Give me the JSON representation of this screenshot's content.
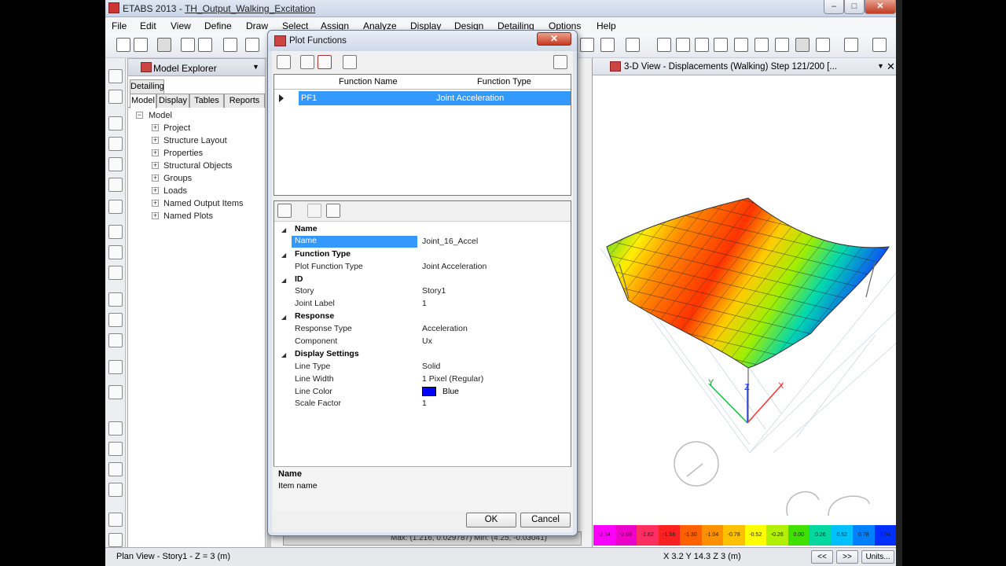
{
  "window": {
    "app": "ETABS 2013",
    "sep": " - ",
    "file": "TH_Output_Walking_Excitation",
    "min": "–",
    "max": "□",
    "close": "✕"
  },
  "menu": [
    "File",
    "Edit",
    "View",
    "Define",
    "Draw",
    "Select",
    "Assign",
    "Analyze",
    "Display",
    "Design",
    "Detailing",
    "Options",
    "Help"
  ],
  "explorer": {
    "title": "Model Explorer",
    "tabs": [
      "Detailing",
      "Model",
      "Display",
      "Tables",
      "Reports"
    ],
    "tree": {
      "root": "Model",
      "items": [
        "Project",
        "Structure Layout",
        "Properties",
        "Structural Objects",
        "Groups",
        "Loads",
        "Named Output Items",
        "Named Plots"
      ]
    }
  },
  "view3d": {
    "title": "3-D View   - Displacements (Walking)  Step 121/200  [...",
    "axes": {
      "x": "X",
      "y": "Y",
      "z": "Z"
    }
  },
  "colorbar": {
    "labels": [
      "-2.34",
      "-2.08",
      "-1.82",
      "-1.56",
      "-1.30",
      "-1.04",
      "-0.78",
      "-0.52",
      "-0.26",
      "0.00",
      "0.26",
      "0.52",
      "0.78",
      "1.04"
    ],
    "colors": [
      "#ff00ff",
      "#ee00cc",
      "#ff3060",
      "#ff2020",
      "#ff6000",
      "#ff9000",
      "#ffc000",
      "#ffff00",
      "#b0f000",
      "#40e000",
      "#00d8a0",
      "#00c0ff",
      "#0080ff",
      "#0030ff"
    ]
  },
  "dialog": {
    "title": "Plot Functions",
    "table": {
      "headers": [
        "Function Name",
        "Function Type"
      ],
      "rows": [
        {
          "name": "PF1",
          "type": "Joint Acceleration"
        }
      ]
    },
    "properties": {
      "name_cat": "Name",
      "name_key": "Name",
      "name_val": "Joint_16_Accel",
      "ftype_cat": "Function Type",
      "ftype_key": "Plot Function Type",
      "ftype_val": "Joint Acceleration",
      "id_cat": "ID",
      "story_key": "Story",
      "story_val": "Story1",
      "joint_key": "Joint Label",
      "joint_val": "1",
      "resp_cat": "Response",
      "rtype_key": "Response Type",
      "rtype_val": "Acceleration",
      "comp_key": "Component",
      "comp_val": "Ux",
      "disp_cat": "Display Settings",
      "ltype_key": "Line Type",
      "ltype_val": "Solid",
      "lwidth_key": "Line Width",
      "lwidth_val": "1 Pixel (Regular)",
      "lcolor_key": "Line Color",
      "lcolor_val": "Blue",
      "lcolor_hex": "#0000ff",
      "scale_key": "Scale Factor",
      "scale_val": "1"
    },
    "description": {
      "title": "Name",
      "text": "Item name"
    },
    "ok": "OK",
    "cancel": "Cancel"
  },
  "below_dialog": "Max: (1.216, 0.029787)     Min: (4.25, -0.03041)",
  "status": {
    "left": "Plan View - Story1 - Z = 3 (m)",
    "coords": "X 3.2  Y 14.3  Z 3 (m)",
    "prev": "<<",
    "next": ">>",
    "units": "Units..."
  }
}
